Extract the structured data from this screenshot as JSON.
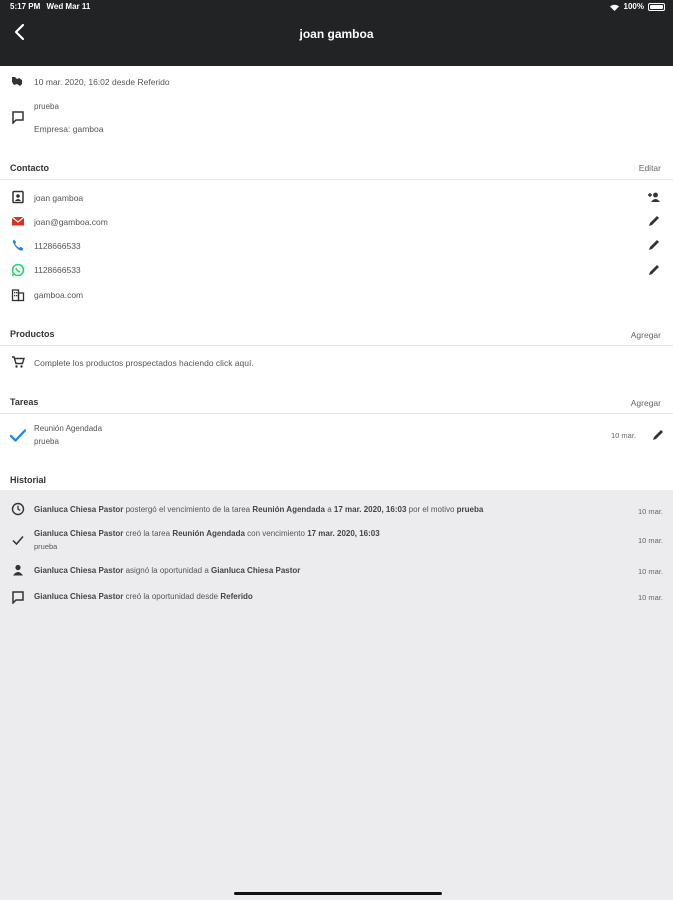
{
  "status": {
    "time": "5:17 PM",
    "date": "Wed Mar 11",
    "battery": "100%"
  },
  "header": {
    "title": "joan gamboa"
  },
  "lead": {
    "origin": "10 mar. 2020, 16:02 desde Referido",
    "note": "prueba",
    "company": "Empresa: gamboa"
  },
  "contacto": {
    "heading": "Contacto",
    "edit": "Editar",
    "name": "joan gamboa",
    "email": "joan@gamboa.com",
    "phone": "1128666533",
    "whatsapp": "1128666533",
    "website": "gamboa.com"
  },
  "productos": {
    "heading": "Productos",
    "add": "Agregar",
    "empty": "Complete los productos prospectados haciendo click aquí."
  },
  "tareas": {
    "heading": "Tareas",
    "add": "Agregar",
    "task": {
      "title": "Reunión Agendada",
      "note": "prueba",
      "date": "10 mar."
    }
  },
  "historial": {
    "heading": "Historial",
    "items": [
      {
        "actor": "Gianluca Chiesa Pastor",
        "t1": "postergó el vencimiento de la tarea",
        "task": "Reunión Agendada",
        "t2": "a",
        "due": "17 mar. 2020, 16:03",
        "t3": "por el motivo",
        "reason": "prueba",
        "date": "10 mar."
      },
      {
        "actor": "Gianluca Chiesa Pastor",
        "t1": "creó la tarea",
        "task": "Reunión Agendada",
        "t2": "con vencimiento",
        "due": "17 mar. 2020, 16:03",
        "note": "prueba",
        "date": "10 mar."
      },
      {
        "actor": "Gianluca Chiesa Pastor",
        "t1": "asignó la oportunidad a",
        "target": "Gianluca Chiesa Pastor",
        "date": "10 mar."
      },
      {
        "actor": "Gianluca Chiesa Pastor",
        "t1": "creó la oportunidad desde",
        "source": "Referido",
        "date": "10 mar."
      }
    ]
  },
  "colors": {
    "header_bg": "#222325",
    "accent_blue": "#1e88e5",
    "gmail_red": "#d93025",
    "whatsapp_green": "#25d366"
  }
}
